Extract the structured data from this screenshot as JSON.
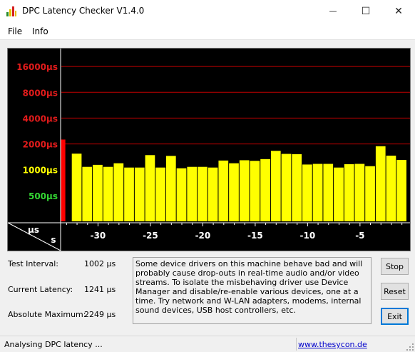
{
  "window": {
    "title": "DPC Latency Checker V1.4.0",
    "minimize_glyph": "—",
    "maximize_glyph": "☐",
    "close_glyph": "✕"
  },
  "menu": {
    "items": [
      "File",
      "Info"
    ]
  },
  "chart_data": {
    "type": "bar",
    "title": "",
    "y_unit_label": "µs",
    "x_unit_label": "s",
    "y_scale": "log2",
    "y_tick_labels": [
      {
        "value": 16000,
        "label": "16000µs",
        "color": "#e11b1b"
      },
      {
        "value": 8000,
        "label": "8000µs",
        "color": "#e11b1b"
      },
      {
        "value": 4000,
        "label": "4000µs",
        "color": "#e11b1b"
      },
      {
        "value": 2000,
        "label": "2000µs",
        "color": "#e11b1b"
      },
      {
        "value": 1000,
        "label": "1000µs",
        "color": "#ffff00"
      },
      {
        "value": 500,
        "label": "500µs",
        "color": "#33d633"
      }
    ],
    "gridlines": [
      16000,
      8000,
      4000,
      2000
    ],
    "x_ticks": [
      {
        "value": -30,
        "label": "-30"
      },
      {
        "value": -25,
        "label": "-25"
      },
      {
        "value": -20,
        "label": "-20"
      },
      {
        "value": -15,
        "label": "-15"
      },
      {
        "value": -10,
        "label": "-10"
      },
      {
        "value": -5,
        "label": "-5"
      }
    ],
    "x": [
      -33,
      -32,
      -31,
      -30,
      -29,
      -28,
      -27,
      -26,
      -25,
      -24,
      -23,
      -22,
      -21,
      -20,
      -19,
      -18,
      -17,
      -16,
      -15,
      -14,
      -13,
      -12,
      -11,
      -10,
      -9,
      -8,
      -7,
      -6,
      -5,
      -4,
      -3,
      -2,
      -1
    ],
    "values": [
      2249,
      1540,
      1080,
      1140,
      1080,
      1190,
      1060,
      1060,
      1480,
      1060,
      1450,
      1040,
      1080,
      1080,
      1060,
      1280,
      1190,
      1290,
      1270,
      1330,
      1660,
      1530,
      1520,
      1150,
      1170,
      1170,
      1060,
      1160,
      1170,
      1100,
      1880,
      1460,
      1300
    ],
    "bar_colors": [
      "#ff0000",
      "#ffff00"
    ],
    "ylim": [
      250,
      24000
    ],
    "grid": true,
    "colors": {
      "background": "#000000",
      "grid": "#c00000",
      "normal_bar": "#ffff00",
      "alarm_bar": "#ff0000",
      "axis_text": "#ffffff"
    }
  },
  "stats": {
    "test_interval_label": "Test Interval:",
    "test_interval_value": "1002 µs",
    "current_latency_label": "Current Latency:",
    "current_latency_value": "1241 µs",
    "absolute_maximum_label": "Absolute Maximum:",
    "absolute_maximum_value": "2249 µs"
  },
  "message": "Some device drivers on this machine behave bad and will probably cause drop-outs in real-time audio and/or video streams. To isolate the misbehaving driver use Device Manager and disable/re-enable various devices, one at a time. Try network and W-LAN adapters, modems, internal sound devices, USB host controllers, etc.",
  "buttons": {
    "stop": "Stop",
    "reset": "Reset",
    "exit": "Exit"
  },
  "status": {
    "text": "Analysing DPC latency ...",
    "link": "www.thesycon.de"
  }
}
